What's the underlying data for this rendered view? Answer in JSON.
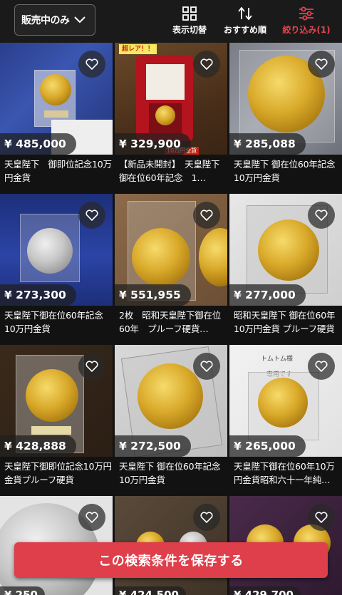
{
  "header": {
    "filter_select": "販売中のみ",
    "view_toggle": "表示切替",
    "sort": "おすすめ順",
    "refine": "絞り込み(1)"
  },
  "items": [
    {
      "price": "¥ 485,000",
      "title": "天皇陛下　御即位記念10万円金貨"
    },
    {
      "price": "¥ 329,900",
      "title": "【新品未開封】　天皇陛下　御在位60年記念　1…",
      "badge": "超レア！！",
      "thumb_label": "10万円金貨"
    },
    {
      "price": "¥ 285,088",
      "title": "天皇陛下 御在位60年記念 10万円金貨"
    },
    {
      "price": "¥ 273,300",
      "title": "天皇陛下御在位60年記念 10万円金貨"
    },
    {
      "price": "¥ 551,955",
      "title": "2枚　昭和天皇陛下御在位60年　プルーフ硬貨…"
    },
    {
      "price": "¥ 277,000",
      "title": "昭和天皇陛下 御在位60年 10万円金貨 プルーフ硬貨"
    },
    {
      "price": "¥ 428,888",
      "title": "天皇陛下御即位記念10万円金貨プルーフ硬貨"
    },
    {
      "price": "¥ 272,500",
      "title": "天皇陛下 御在位60年記念 10万円金貨"
    },
    {
      "price": "¥ 265,000",
      "title": "天皇陛下御在位60年10万円金貨昭和六十一年純…",
      "thumb_label": "トムトム様",
      "thumb_label2": "専用です"
    },
    {
      "price": "¥ 250"
    },
    {
      "price": "¥ 424,500"
    },
    {
      "price": "¥ 429,700"
    }
  ],
  "cta": {
    "label": "この検索条件を保存する"
  },
  "colors": {
    "accent": "#df3e4b",
    "background": "#121212"
  }
}
